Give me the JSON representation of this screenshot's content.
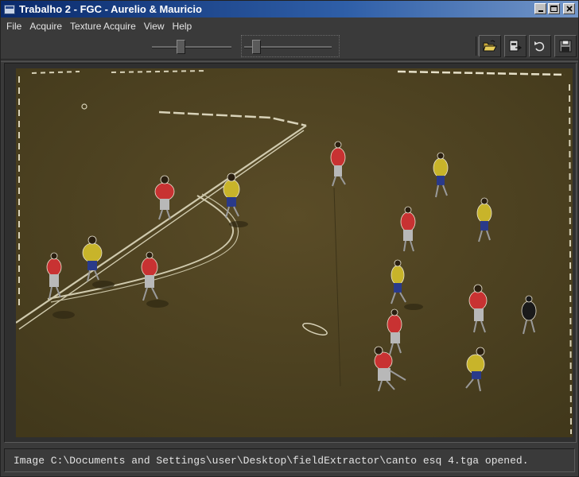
{
  "window": {
    "title": "Trabalho 2 - FGC - Aurelio & Mauricio",
    "icon": "app-window-icon",
    "controls": [
      "minimize-icon",
      "maximize-icon",
      "close-icon"
    ]
  },
  "menu": {
    "items": [
      "File",
      "Acquire",
      "Texture Acquire",
      "View",
      "Help"
    ]
  },
  "toolbar": {
    "slider1_level": 0.35,
    "slider2_level": 0.1,
    "buttons": [
      "open-folder-icon",
      "export-icon",
      "undo-icon",
      "save-icon"
    ]
  },
  "image_view": {
    "content": "soccer-field-extraction-image",
    "field_color": "#4f4321",
    "line_color": "#d8d2b8",
    "team_a_color": "#c83232",
    "team_b_color": "#c8b42a"
  },
  "status": {
    "message": "Image C:\\Documents and Settings\\user\\Desktop\\fieldExtractor\\canto esq 4.tga opened."
  }
}
